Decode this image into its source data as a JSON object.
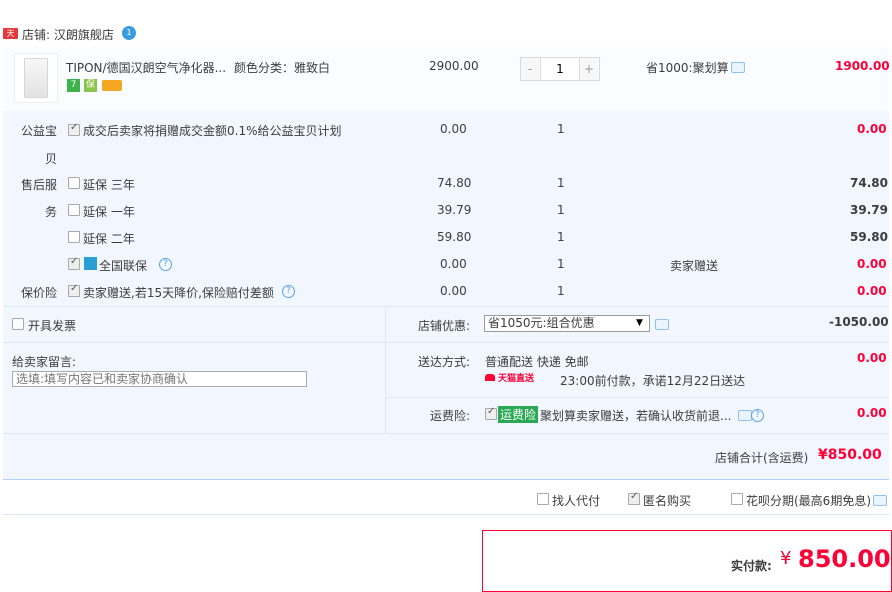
{
  "shop": {
    "badge": "天猫",
    "label": "店铺: 汉朗旗舰店",
    "wangwang": "1"
  },
  "item": {
    "title": "TIPON/德国汉朗空气净化器...",
    "sku": "颜色分类：雅致白",
    "price": "2900.00",
    "qty_minus": "-",
    "qty": "1",
    "qty_plus": "+",
    "discount": "省1000:聚划算",
    "subtotal": "1900.00",
    "badges": [
      "7",
      "保"
    ]
  },
  "services": {
    "charity_label_1": "公益宝",
    "charity_label_2": "贝",
    "charity_text": "成交后卖家将捐赠成交金额0.1%给公益宝贝计划",
    "charity_price": "0.00",
    "charity_qty": "1",
    "charity_total": "0.00",
    "after_sale_label_1": "售后服",
    "after_sale_label_2": "务",
    "warranties": [
      {
        "label": "延保 三年",
        "price": "74.80",
        "qty": "1",
        "total": "74.80"
      },
      {
        "label": "延保 一年",
        "price": "39.79",
        "qty": "1",
        "total": "39.79"
      },
      {
        "label": "延保 二年",
        "price": "59.80",
        "qty": "1",
        "total": "59.80"
      }
    ],
    "national": {
      "label": "全国联保",
      "price": "0.00",
      "qty": "1",
      "note": "卖家赠送",
      "total": "0.00"
    },
    "insurance_label": "保价险",
    "insurance": {
      "label": "卖家赠送,若15天降价,保险赔付差额",
      "price": "0.00",
      "qty": "1",
      "total": "0.00"
    }
  },
  "invoice": {
    "label": "开具发票"
  },
  "promo": {
    "label": "店铺优惠:",
    "selected": "省1050元:组合优惠",
    "amount": "-1050.00"
  },
  "message": {
    "label": "给卖家留言:",
    "placeholder": "选填:填写内容已和卖家协商确认"
  },
  "delivery": {
    "label": "送达方式:",
    "method": "普通配送 快递 免邮",
    "badge": "天猫直送",
    "promise": "23:00前付款，承诺12月22日送达",
    "amount": "0.00"
  },
  "freight": {
    "label": "运费险:",
    "badge": "运费险",
    "text": "聚划算卖家赠送，若确认收货前退...",
    "amount": "0.00"
  },
  "shop_total": {
    "label": "店铺合计(含运费)",
    "amount": "¥850.00"
  },
  "options": {
    "proxy": "找人代付",
    "anonymous": "匿名购买",
    "installment": "花呗分期(最高6期免息)"
  },
  "pay": {
    "label": "实付款:",
    "currency": "¥",
    "amount": "850.00"
  }
}
